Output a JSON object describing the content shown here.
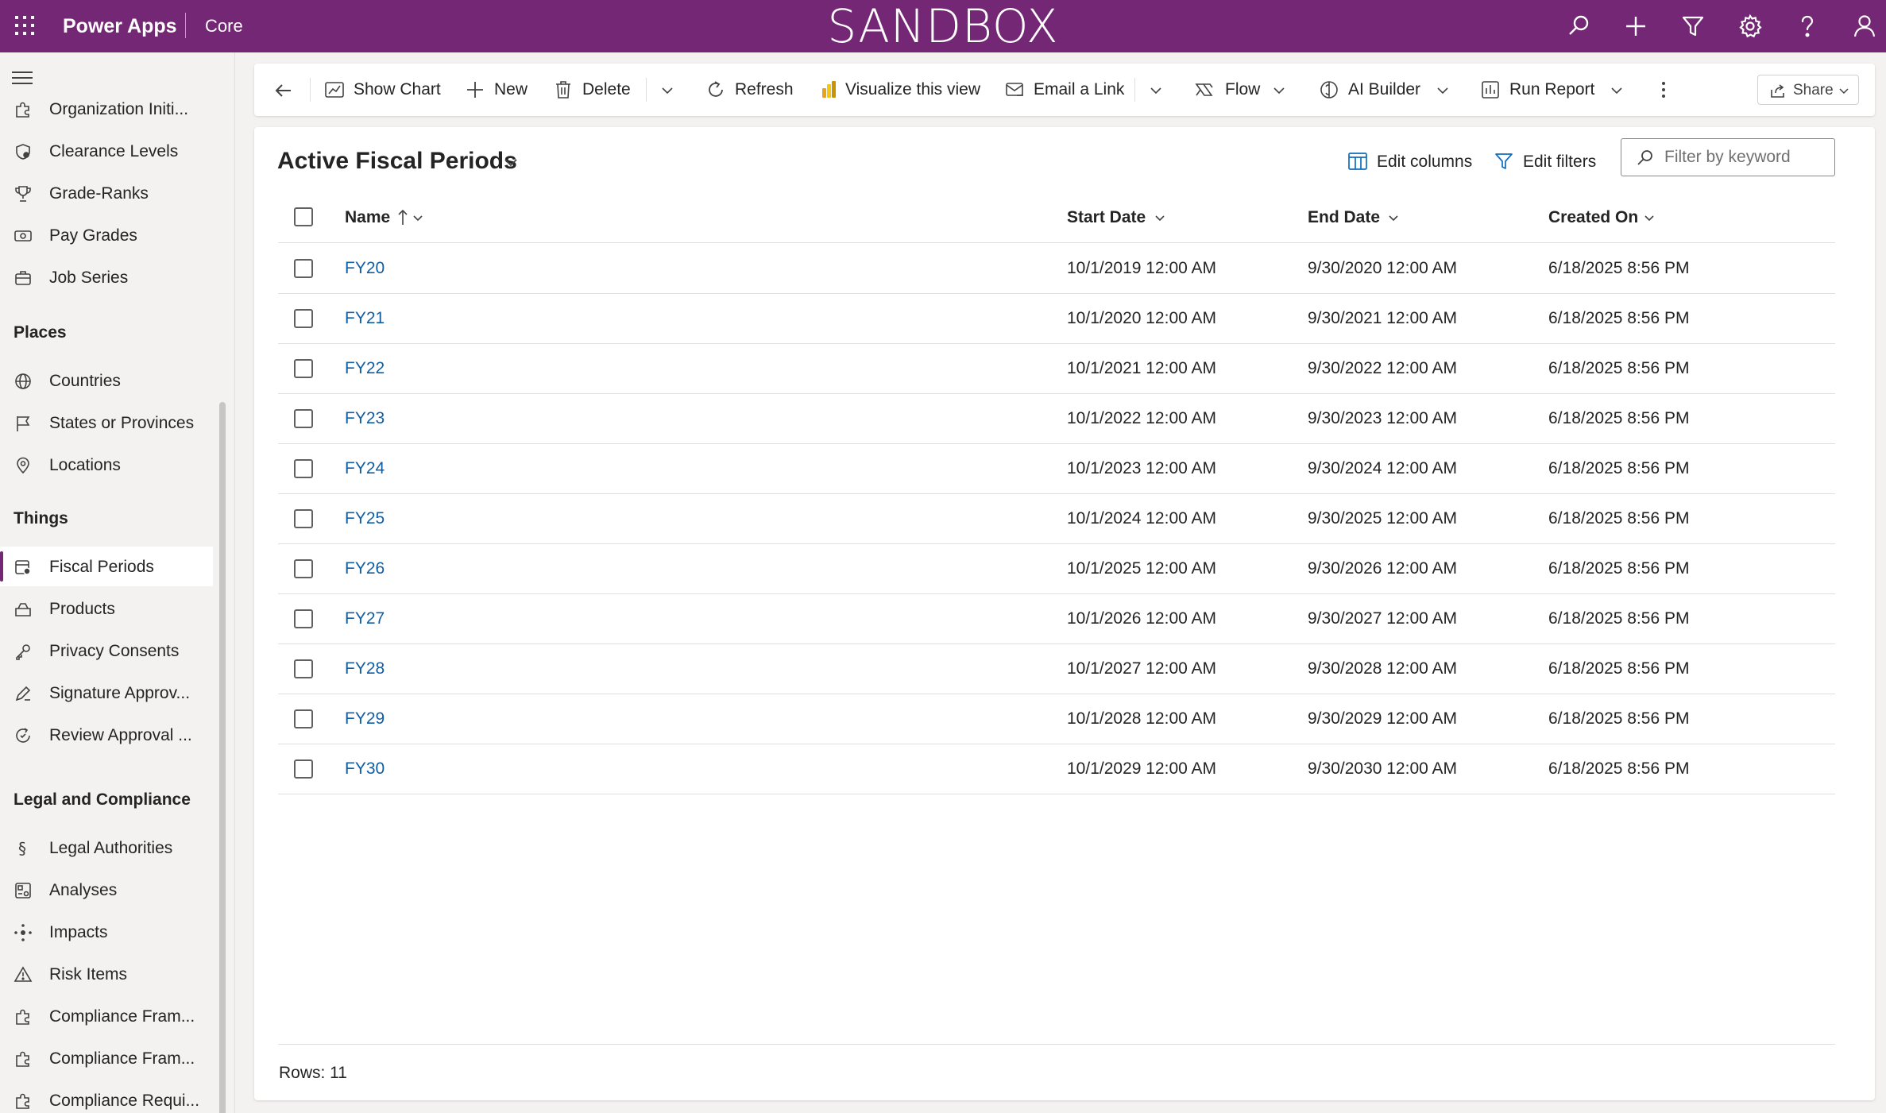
{
  "topbar": {
    "app_name": "Power Apps",
    "environment": "Core",
    "banner": "SANDBOX",
    "icons": [
      "search-icon",
      "add-icon",
      "filter-icon",
      "settings-icon",
      "help-icon",
      "account-icon"
    ]
  },
  "sidebar": {
    "items_top": [
      {
        "label": "Organization Initi...",
        "icon": "puzzle-icon"
      },
      {
        "label": "Clearance Levels",
        "icon": "shield-icon"
      },
      {
        "label": "Grade-Ranks",
        "icon": "trophy-icon"
      },
      {
        "label": "Pay Grades",
        "icon": "money-icon"
      },
      {
        "label": "Job Series",
        "icon": "briefcase-icon"
      }
    ],
    "groups": [
      {
        "title": "Places",
        "items": [
          {
            "label": "Countries",
            "icon": "globe-icon"
          },
          {
            "label": "States or Provinces",
            "icon": "flag-icon"
          },
          {
            "label": "Locations",
            "icon": "location-icon"
          }
        ]
      },
      {
        "title": "Things",
        "items": [
          {
            "label": "Fiscal Periods",
            "icon": "calendar-icon",
            "active": true
          },
          {
            "label": "Products",
            "icon": "box-icon"
          },
          {
            "label": "Privacy Consents",
            "icon": "key-icon"
          },
          {
            "label": "Signature Approv...",
            "icon": "signature-icon"
          },
          {
            "label": "Review Approval ...",
            "icon": "review-icon"
          }
        ]
      },
      {
        "title": "Legal and Compliance",
        "items": [
          {
            "label": "Legal Authorities",
            "icon": "section-icon"
          },
          {
            "label": "Analyses",
            "icon": "analysis-icon"
          },
          {
            "label": "Impacts",
            "icon": "impact-icon"
          },
          {
            "label": "Risk Items",
            "icon": "warning-icon"
          },
          {
            "label": "Compliance Fram...",
            "icon": "puzzle-icon"
          },
          {
            "label": "Compliance Fram...",
            "icon": "puzzle-icon"
          },
          {
            "label": "Compliance Requi...",
            "icon": "puzzle-icon"
          }
        ]
      }
    ]
  },
  "commandbar": {
    "show_chart": "Show Chart",
    "new": "New",
    "delete": "Delete",
    "refresh": "Refresh",
    "visualize": "Visualize this view",
    "email_link": "Email a Link",
    "flow": "Flow",
    "ai_builder": "AI Builder",
    "run_report": "Run Report",
    "share": "Share"
  },
  "view": {
    "title": "Active Fiscal Periods",
    "edit_columns": "Edit columns",
    "edit_filters": "Edit filters",
    "filter_placeholder": "Filter by keyword",
    "columns": {
      "name": "Name",
      "start_date": "Start Date",
      "end_date": "End Date",
      "created_on": "Created On"
    },
    "sort": {
      "column": "Name",
      "direction": "ascending"
    },
    "rows": [
      {
        "name": "FY20",
        "start": "10/1/2019 12:00 AM",
        "end": "9/30/2020 12:00 AM",
        "created": "6/18/2025 8:56 PM"
      },
      {
        "name": "FY21",
        "start": "10/1/2020 12:00 AM",
        "end": "9/30/2021 12:00 AM",
        "created": "6/18/2025 8:56 PM"
      },
      {
        "name": "FY22",
        "start": "10/1/2021 12:00 AM",
        "end": "9/30/2022 12:00 AM",
        "created": "6/18/2025 8:56 PM"
      },
      {
        "name": "FY23",
        "start": "10/1/2022 12:00 AM",
        "end": "9/30/2023 12:00 AM",
        "created": "6/18/2025 8:56 PM"
      },
      {
        "name": "FY24",
        "start": "10/1/2023 12:00 AM",
        "end": "9/30/2024 12:00 AM",
        "created": "6/18/2025 8:56 PM"
      },
      {
        "name": "FY25",
        "start": "10/1/2024 12:00 AM",
        "end": "9/30/2025 12:00 AM",
        "created": "6/18/2025 8:56 PM"
      },
      {
        "name": "FY26",
        "start": "10/1/2025 12:00 AM",
        "end": "9/30/2026 12:00 AM",
        "created": "6/18/2025 8:56 PM"
      },
      {
        "name": "FY27",
        "start": "10/1/2026 12:00 AM",
        "end": "9/30/2027 12:00 AM",
        "created": "6/18/2025 8:56 PM"
      },
      {
        "name": "FY28",
        "start": "10/1/2027 12:00 AM",
        "end": "9/30/2028 12:00 AM",
        "created": "6/18/2025 8:56 PM"
      },
      {
        "name": "FY29",
        "start": "10/1/2028 12:00 AM",
        "end": "9/30/2029 12:00 AM",
        "created": "6/18/2025 8:56 PM"
      },
      {
        "name": "FY30",
        "start": "10/1/2029 12:00 AM",
        "end": "9/30/2030 12:00 AM",
        "created": "6/18/2025 8:56 PM"
      }
    ],
    "rows_count": "Rows: 11"
  },
  "colors": {
    "brand": "#742774",
    "link": "#115ea3",
    "active_accent": "#742774"
  }
}
